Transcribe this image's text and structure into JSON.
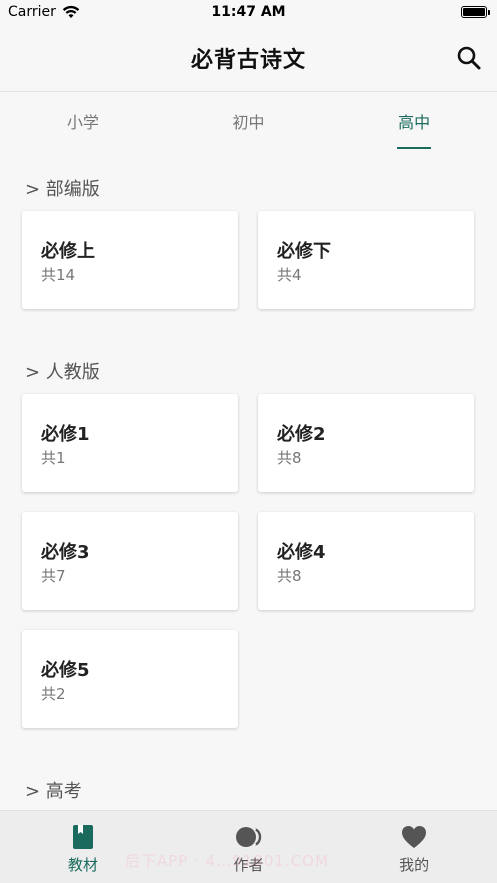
{
  "status": {
    "carrier": "Carrier",
    "time": "11:47 AM"
  },
  "header": {
    "title": "必背古诗文",
    "search_icon": "search-icon"
  },
  "tabs": [
    {
      "label": "小学",
      "active": false
    },
    {
      "label": "初中",
      "active": false
    },
    {
      "label": "高中",
      "active": true
    }
  ],
  "sections": [
    {
      "title": "> 部编版",
      "cards": [
        {
          "title": "必修上",
          "count": "共14"
        },
        {
          "title": "必修下",
          "count": "共4"
        }
      ]
    },
    {
      "title": "> 人教版",
      "cards": [
        {
          "title": "必修1",
          "count": "共1"
        },
        {
          "title": "必修2",
          "count": "共8"
        },
        {
          "title": "必修3",
          "count": "共7"
        },
        {
          "title": "必修4",
          "count": "共8"
        },
        {
          "title": "必修5",
          "count": "共2"
        }
      ]
    },
    {
      "title": "> 高考",
      "cards": []
    }
  ],
  "bottom_nav": [
    {
      "label": "教材",
      "icon": "book-icon",
      "active": true
    },
    {
      "label": "作者",
      "icon": "author-icon",
      "active": false
    },
    {
      "label": "我的",
      "icon": "heart-icon",
      "active": false
    }
  ],
  "watermark": "后下APP · 4…91801.COM",
  "colors": {
    "accent": "#1a6b5e",
    "background": "#f7f7f7",
    "card": "#ffffff"
  }
}
